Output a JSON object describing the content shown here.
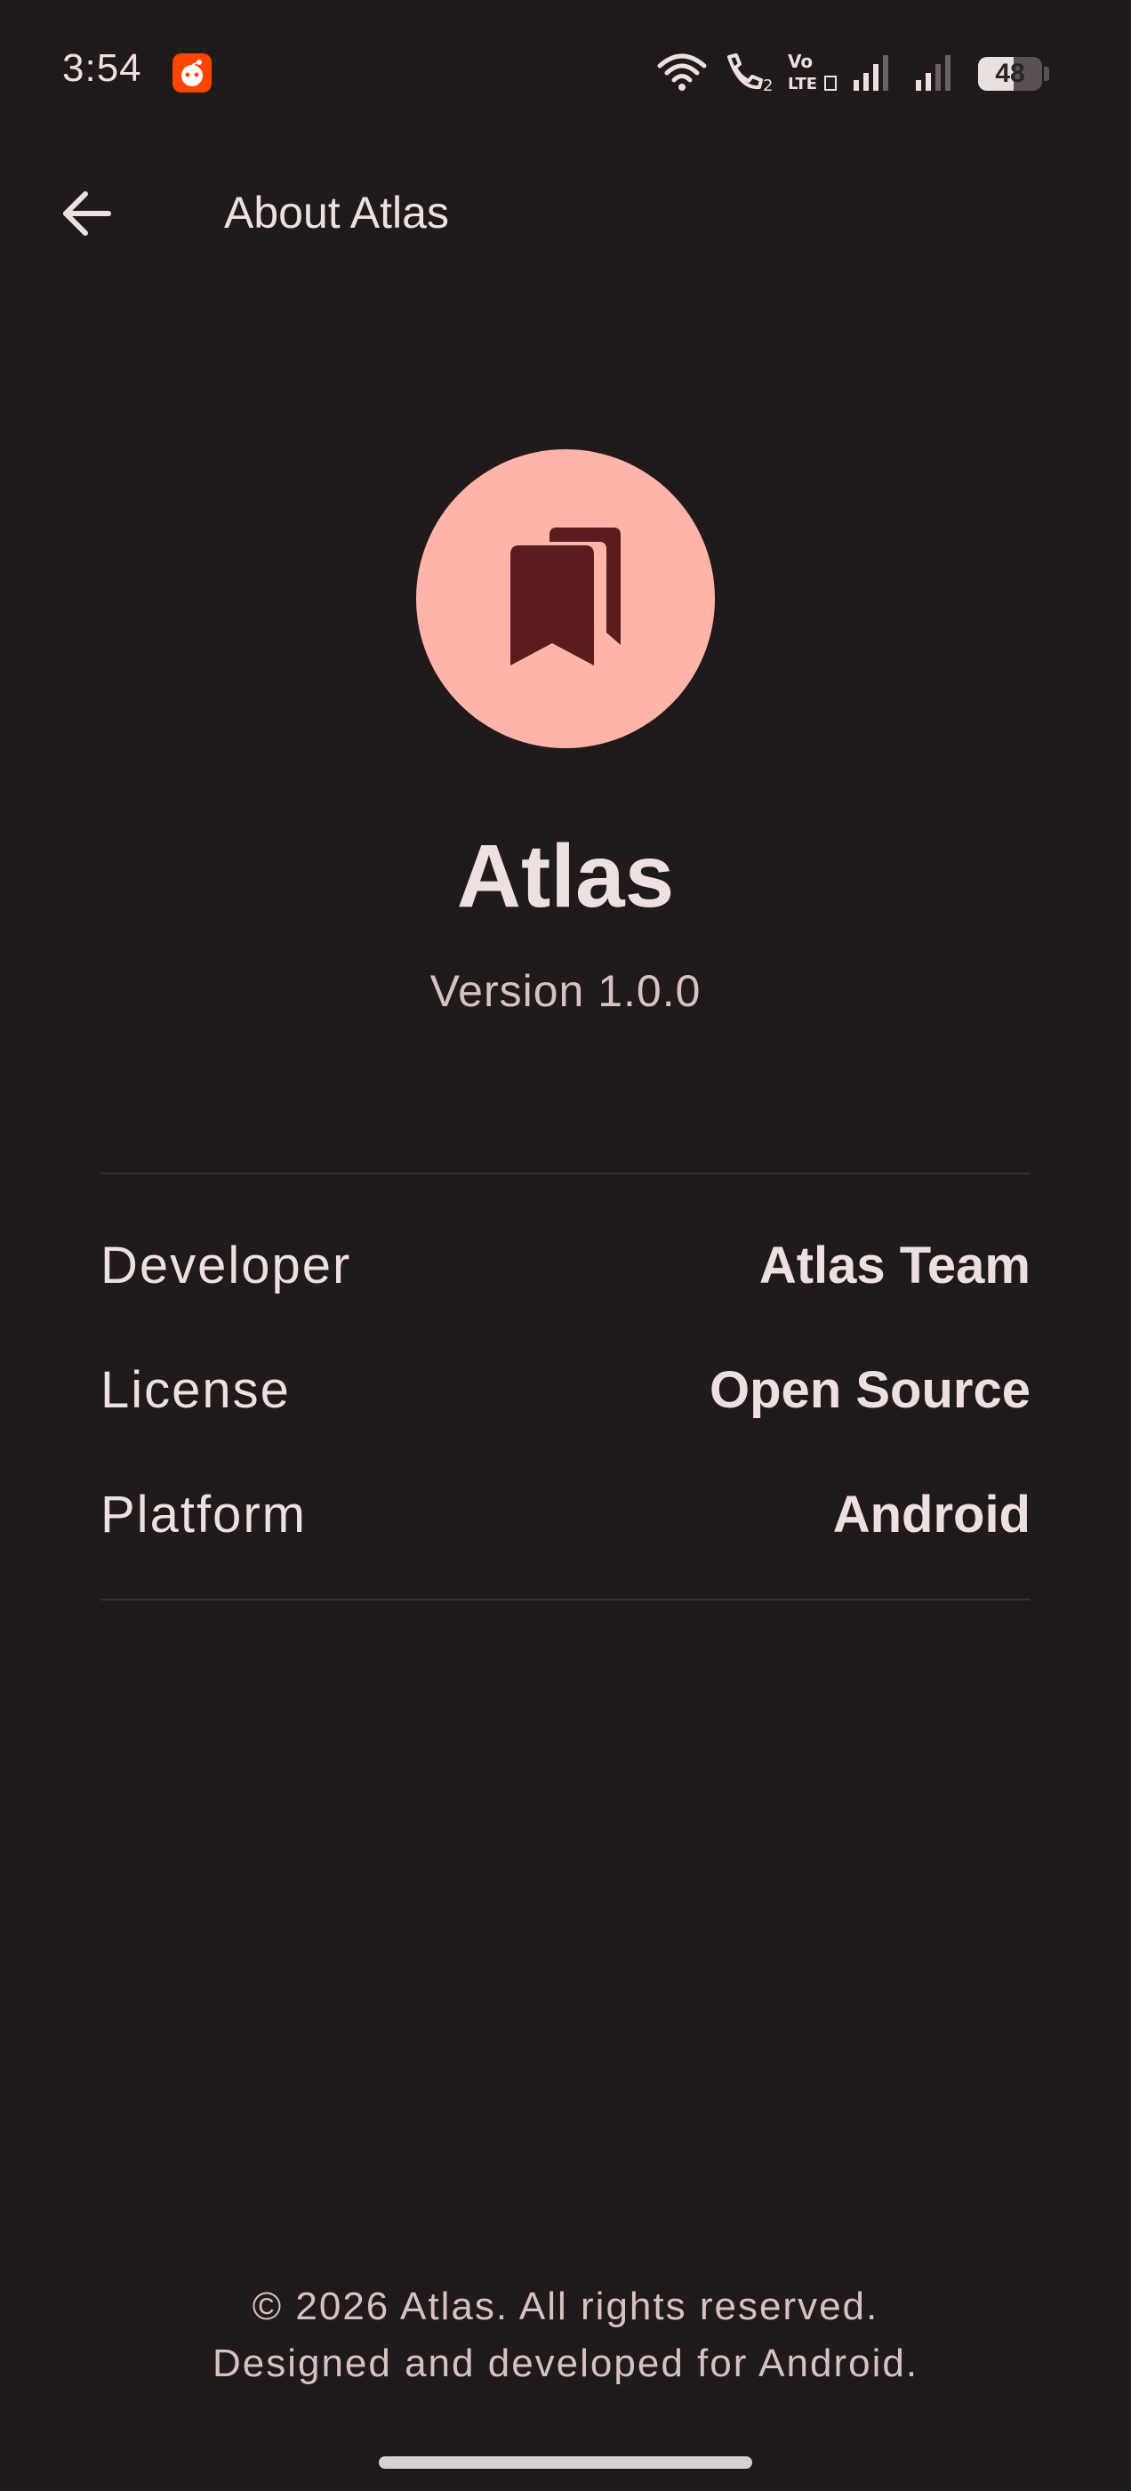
{
  "status_bar": {
    "time": "3:54",
    "battery_level": "48",
    "icons": [
      "reddit-notification-icon",
      "wifi-icon",
      "wifi-calling-icon",
      "volte-icon",
      "signal-icon",
      "signal-icon"
    ]
  },
  "app_bar": {
    "title": "About Atlas",
    "back_icon": "arrow-back-icon"
  },
  "app": {
    "logo_icon": "bookmarks-icon",
    "name": "Atlas",
    "version": "Version 1.0.0"
  },
  "info": {
    "rows": [
      {
        "label": "Developer",
        "value": "Atlas Team"
      },
      {
        "label": "License",
        "value": "Open Source"
      },
      {
        "label": "Platform",
        "value": "Android"
      }
    ]
  },
  "footer": {
    "copyright": "© 2026 Atlas. All rights reserved.",
    "tagline": "Designed and developed for Android."
  },
  "colors": {
    "background": "#211a1a",
    "logo_background": "#ffb4ab",
    "logo_foreground": "#5a1c1c",
    "text_primary": "#ede0df",
    "text_secondary": "#d8c2bf",
    "divider": "#3a3131"
  }
}
